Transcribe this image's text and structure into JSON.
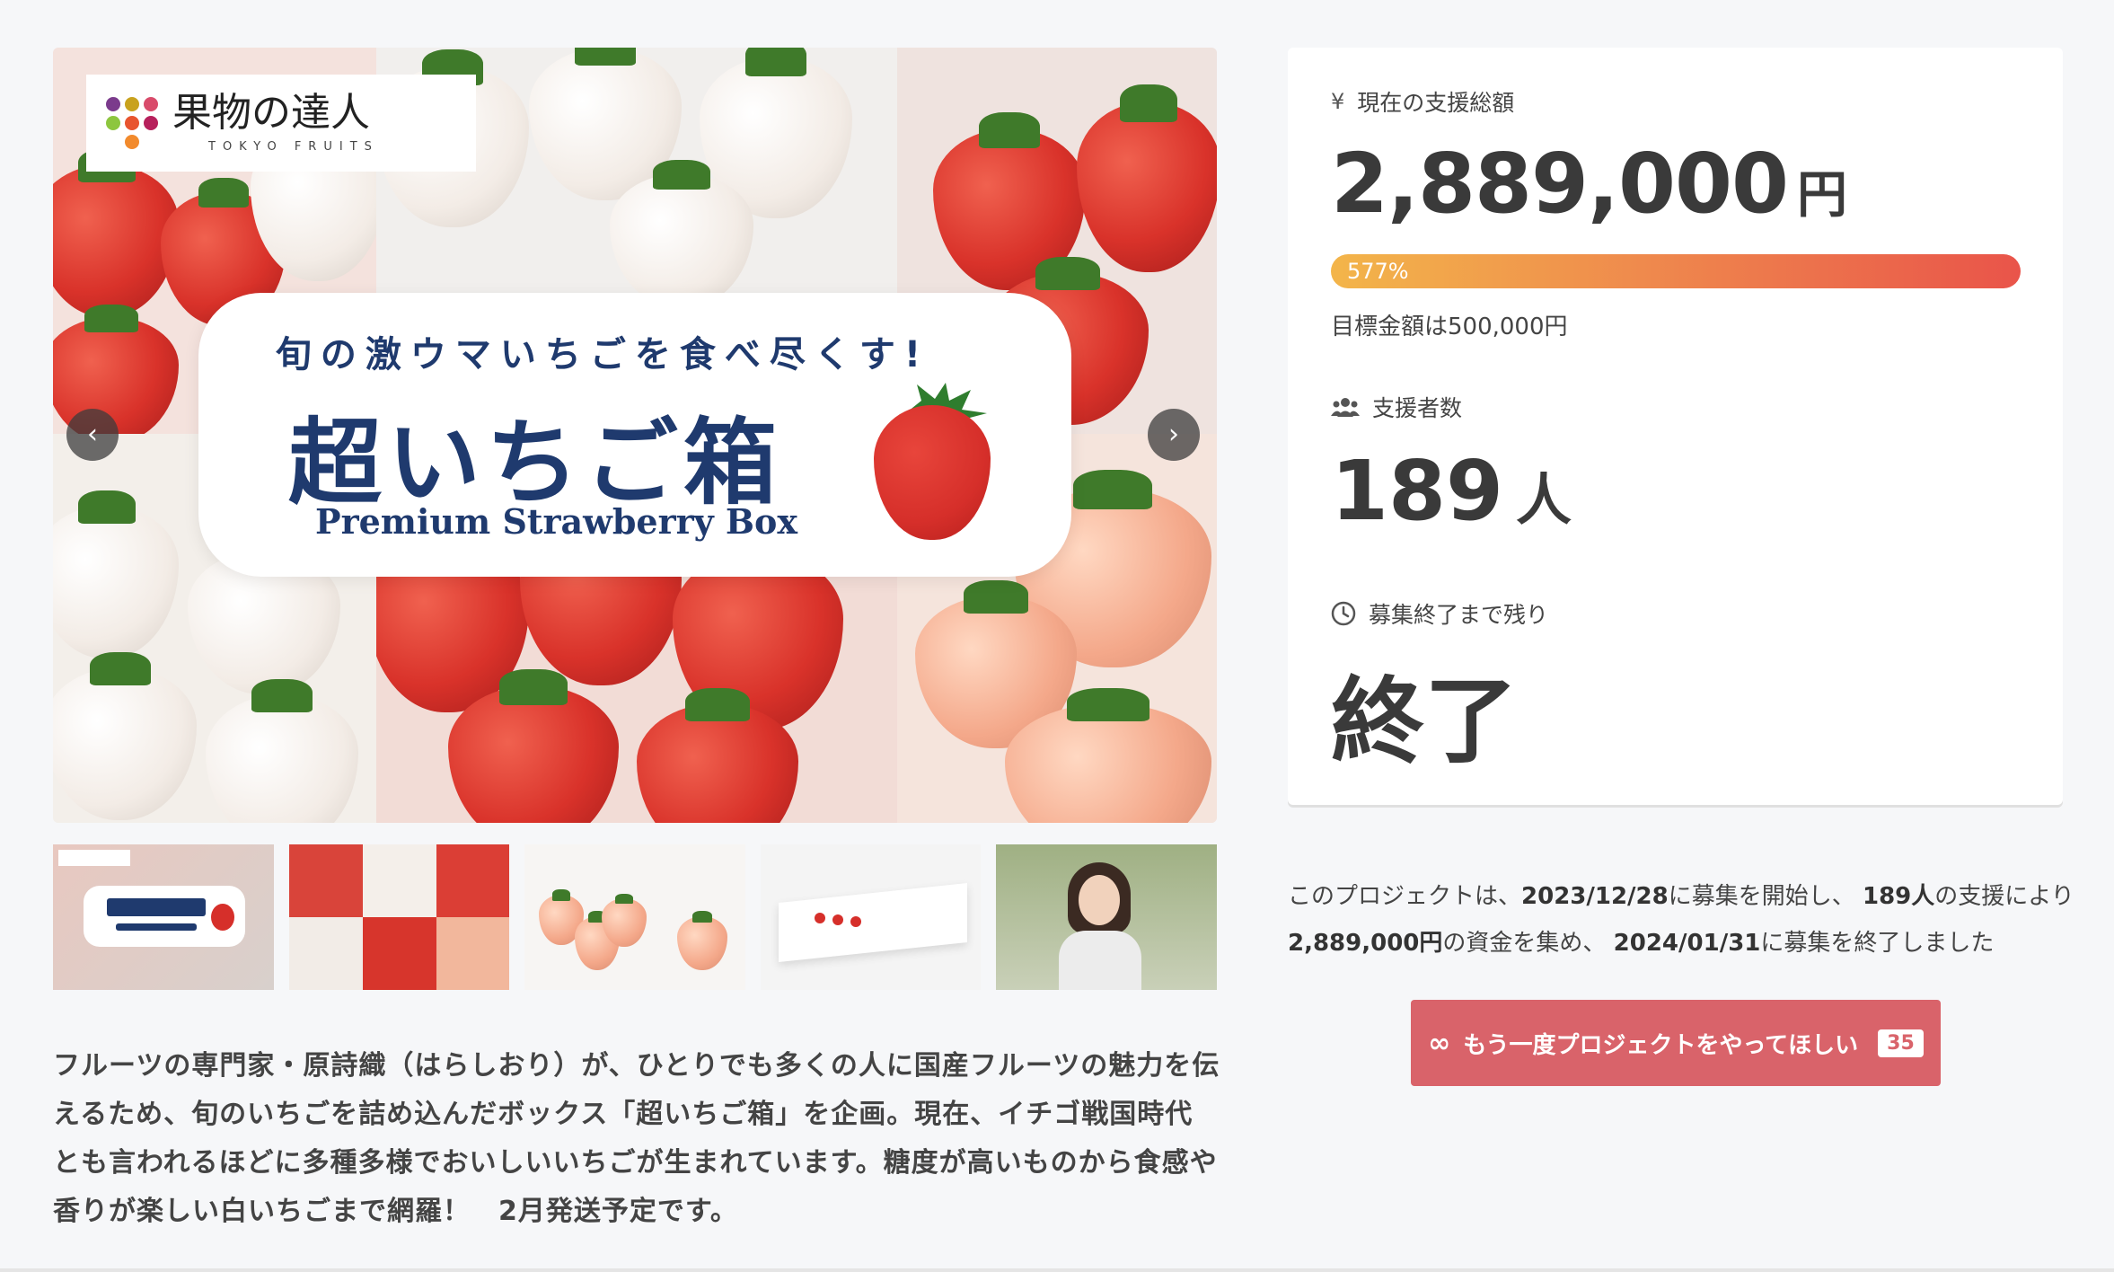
{
  "hero": {
    "logo": {
      "name": "果物の達人",
      "sub": "TOKYO FRUITS"
    },
    "banner": {
      "subtitle": "旬の激ウマいちごを食べ尽くす!",
      "title": "超いちご箱",
      "english": "Premium Strawberry Box"
    },
    "prev_icon": "‹",
    "next_icon": "›"
  },
  "thumbnails": [
    {
      "name": "thumb-banner"
    },
    {
      "name": "thumb-strawberry-grid"
    },
    {
      "name": "thumb-white-strawberries"
    },
    {
      "name": "thumb-box"
    },
    {
      "name": "thumb-person"
    }
  ],
  "description": "フルーツの専門家・原詩織（はらしおり）が、ひとりでも多くの人に国産フルーツの魅力を伝えるため、旬のいちごを詰め込んだボックス「超いちご箱」を企画。現在、イチゴ戦国時代とも言われるほどに多種多様でおいしいいちごが生まれています。糖度が高いものから食感や香りが楽しい白いちごまで網羅！　2月発送予定です。",
  "stats": {
    "total_label": "現在の支援総額",
    "total_icon": "¥",
    "total_amount": "2,889,000",
    "total_unit": "円",
    "progress_percent": 577,
    "progress_label": "577%",
    "goal_text": "目標金額は500,000円",
    "backers_label": "支援者数",
    "backers_count": "189",
    "backers_unit": "人",
    "remaining_label": "募集終了まで残り",
    "remaining_value": "終了"
  },
  "summary": {
    "p1": "このプロジェクトは、",
    "start_date": "2023/12/28",
    "p2": "に募集を開始し、 ",
    "backers": "189人",
    "p3": "の支援により ",
    "amount": "2,889,000円",
    "p4": "の資金を集め、 ",
    "end_date": "2024/01/31",
    "p5": "に募集を終了しました"
  },
  "again_button": {
    "icon": "∞",
    "label": "もう一度プロジェクトをやってほしい",
    "count": "35"
  },
  "colors": {
    "accent": "#d9636a",
    "navy": "#1f3a6e",
    "progress_start": "#f3b54a",
    "progress_end": "#e9544a"
  }
}
